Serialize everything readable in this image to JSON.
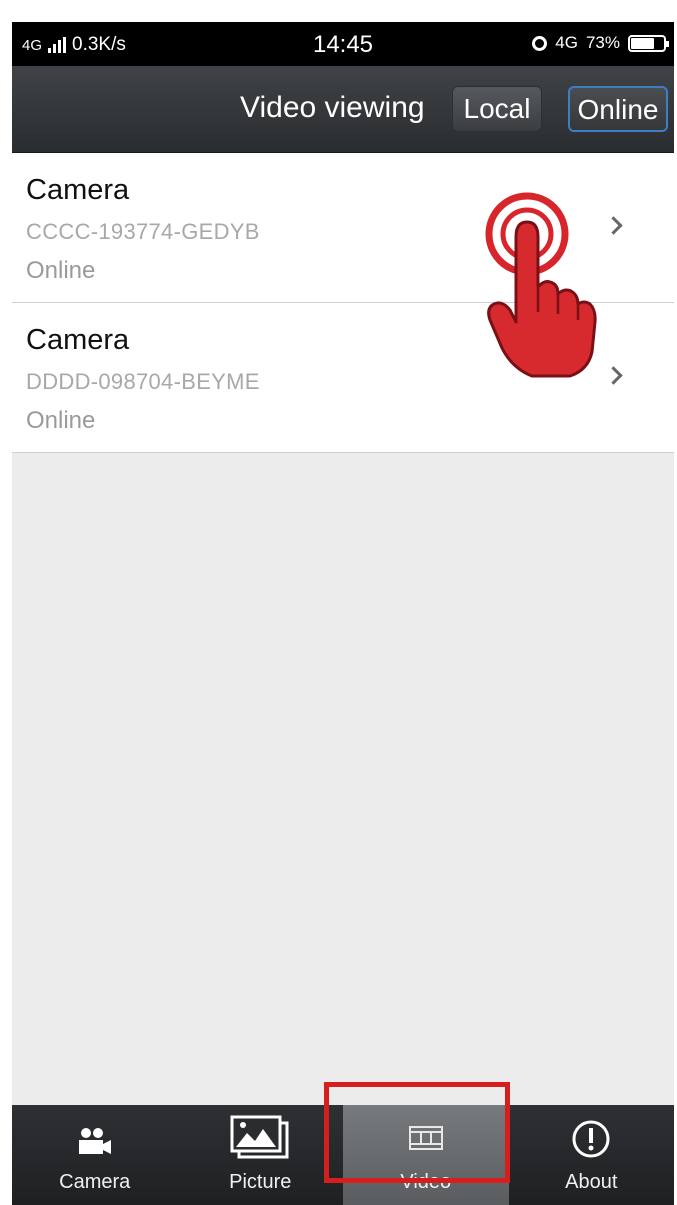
{
  "status_bar": {
    "network": "4G",
    "speed": "0.3K/s",
    "time": "14:45",
    "data_type": "4G",
    "battery": "73%"
  },
  "nav": {
    "title": "Video viewing",
    "local_label": "Local",
    "online_label": "Online"
  },
  "devices": [
    {
      "name": "Camera",
      "id": "CCCC-193774-GEDYB",
      "status": "Online"
    },
    {
      "name": "Camera",
      "id": "DDDD-098704-BEYME",
      "status": "Online"
    }
  ],
  "tabs": [
    {
      "label": "Camera",
      "icon": "camera-icon",
      "active": false
    },
    {
      "label": "Picture",
      "icon": "picture-icon",
      "active": false
    },
    {
      "label": "Video",
      "icon": "video-icon",
      "active": true
    },
    {
      "label": "About",
      "icon": "about-icon",
      "active": false
    }
  ],
  "colors": {
    "highlight": "#d61e1e",
    "online_button_border": "#3b7fc4"
  }
}
